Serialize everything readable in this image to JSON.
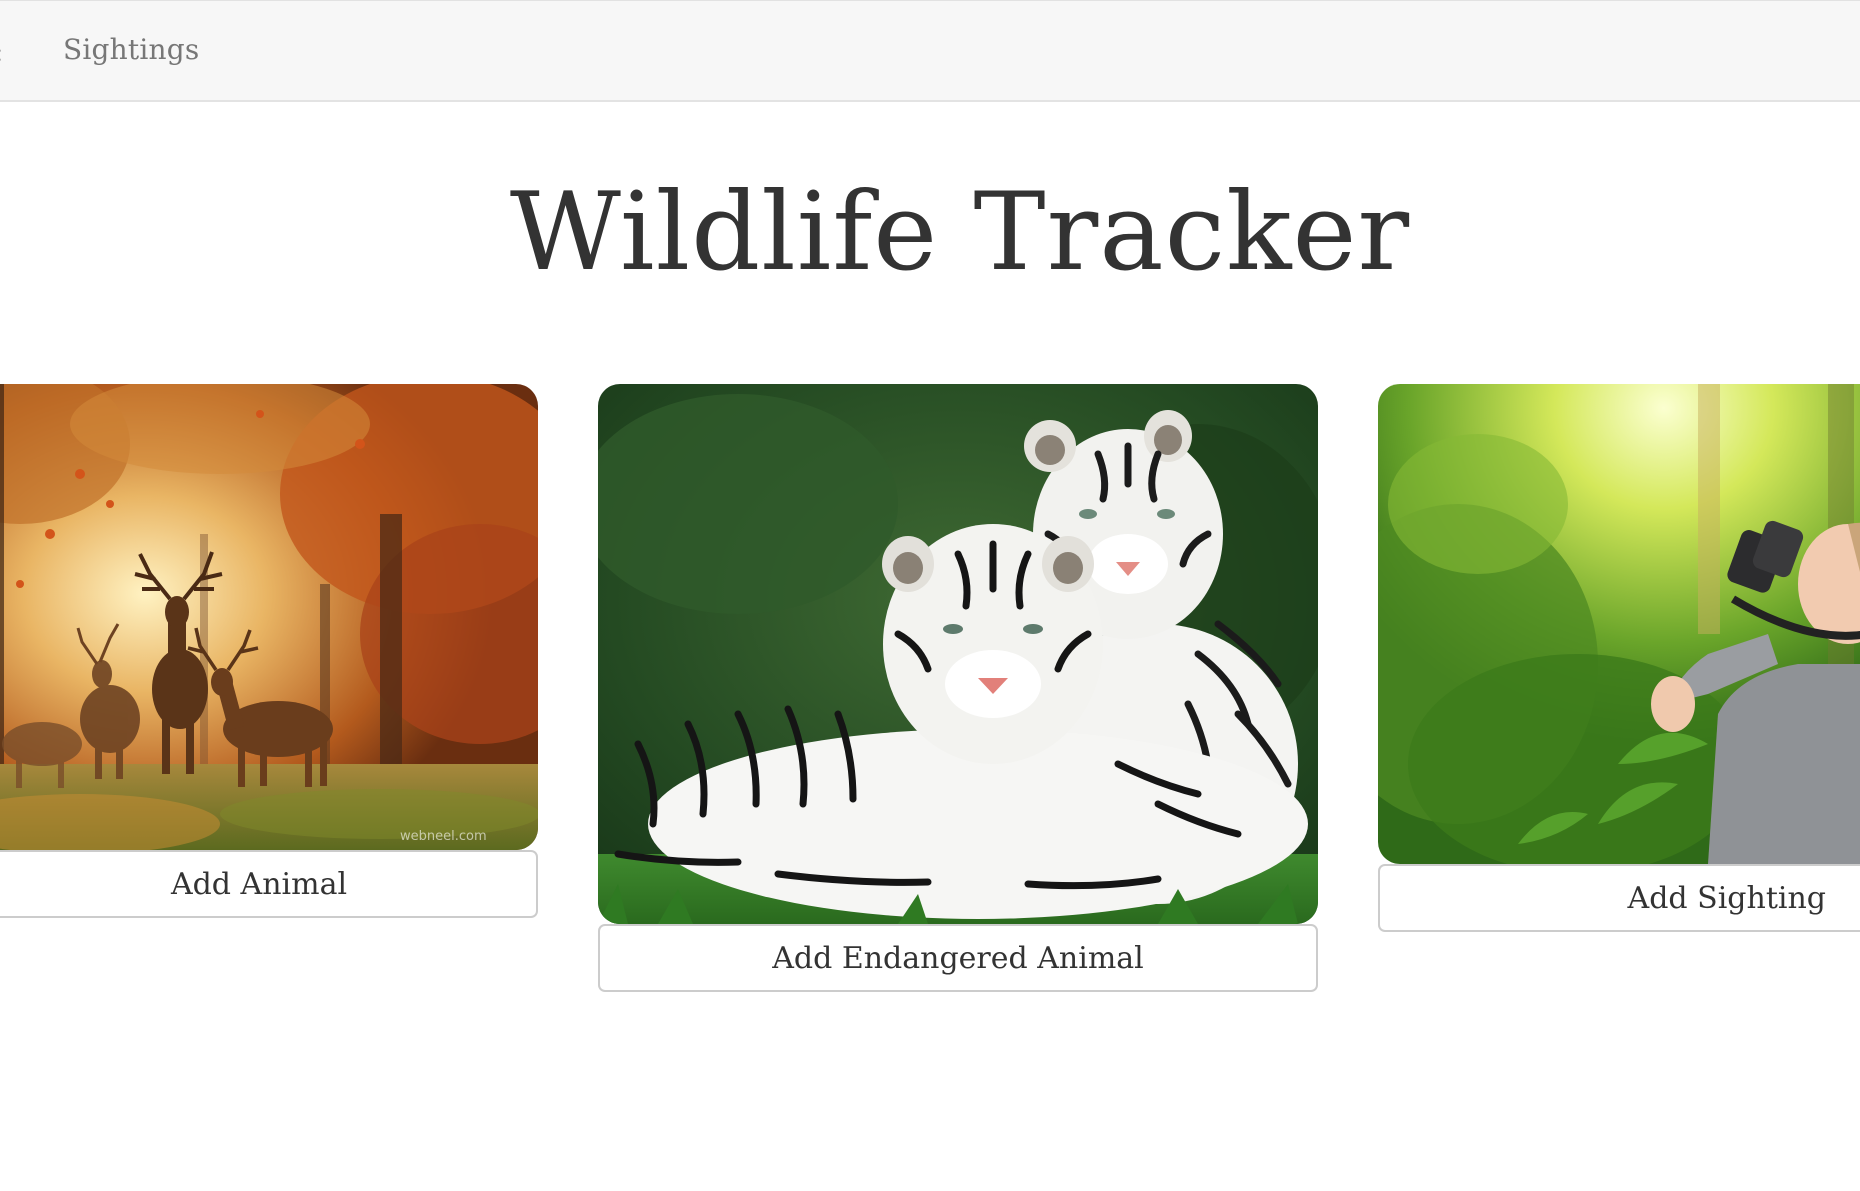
{
  "nav": {
    "partial_link": ":",
    "sightings_label": "Sightings"
  },
  "page": {
    "title": "Wildlife Tracker"
  },
  "cards": [
    {
      "image": "deer-in-autumn-forest",
      "button_label": "Add Animal",
      "watermark": "webneel.com"
    },
    {
      "image": "white-tigers",
      "button_label": "Add Endangered Animal"
    },
    {
      "image": "birdwatcher-with-binoculars",
      "button_label": "Add Sighting"
    }
  ],
  "colors": {
    "navbar_bg": "#f7f7f7",
    "nav_text": "#777777",
    "title_text": "#333333",
    "button_border": "#cccccc"
  }
}
